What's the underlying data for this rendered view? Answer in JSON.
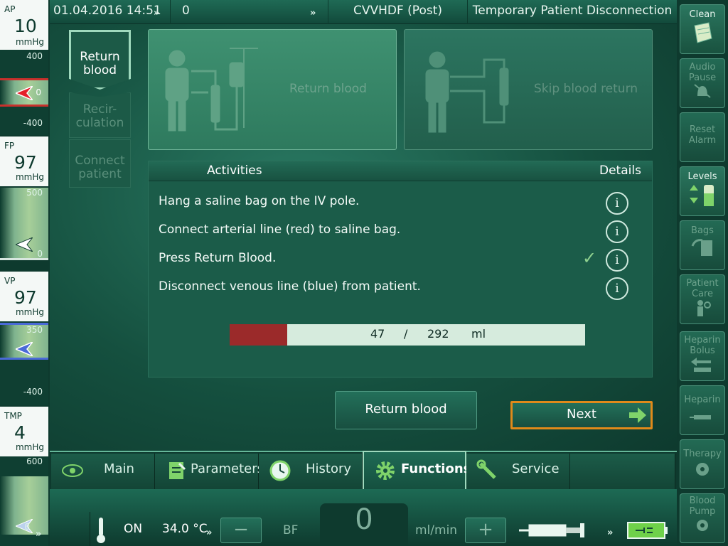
{
  "topbar": {
    "datetime": "01.04.2016 14:51",
    "counter": "0",
    "mode": "CVVHDF (Post)",
    "screen_title": "Temporary Patient Disconnection",
    "more_glyph": "»"
  },
  "pressures": {
    "ap": {
      "name": "AP",
      "value": "10",
      "unit": "mmHg",
      "upper": "400",
      "current": "0",
      "lower": "-400",
      "color": "#e5202a"
    },
    "fp": {
      "name": "FP",
      "value": "97",
      "unit": "mmHg",
      "upper": "500",
      "lower": "0",
      "color": "#ffffff"
    },
    "vp": {
      "name": "VP",
      "value": "97",
      "unit": "mmHg",
      "upper": "350",
      "lower": "-400",
      "color": "#4a6ad8"
    },
    "tmp": {
      "name": "TMP",
      "value": "4",
      "unit": "mmHg",
      "upper": "600",
      "lower": "0",
      "color": "#bcd2ee"
    }
  },
  "steps": [
    {
      "label_line1": "Return",
      "label_line2": "blood",
      "active": true
    },
    {
      "label_line1": "Recir-",
      "label_line2": "culation",
      "active": false
    },
    {
      "label_line1": "Connect",
      "label_line2": "patient",
      "active": false
    }
  ],
  "cards": {
    "return_blood": "Return blood",
    "skip_return": "Skip blood return"
  },
  "activities": {
    "header_activities": "Activities",
    "header_details": "Details",
    "items": [
      {
        "text": "Hang a saline bag on the IV pole.",
        "done": false
      },
      {
        "text": "Connect arterial line (red) to saline bag.",
        "done": false
      },
      {
        "text": "Press Return Blood.",
        "done": true
      },
      {
        "text": "Disconnect venous line (blue) from patient.",
        "done": false
      }
    ],
    "info_glyph": "i",
    "check_glyph": "✓",
    "progress": {
      "current": "47",
      "separator": "/",
      "total": "292",
      "unit": "ml",
      "fraction": 0.161
    }
  },
  "buttons": {
    "return_blood": "Return blood",
    "next": "Next"
  },
  "tabs": [
    {
      "label": "Main",
      "icon": "eye-icon"
    },
    {
      "label": "Parameters",
      "icon": "notepad-icon"
    },
    {
      "label": "History",
      "icon": "clock-icon"
    },
    {
      "label": "Functions",
      "icon": "gear-icon",
      "active": true
    },
    {
      "label": "Service",
      "icon": "wrench-icon"
    }
  ],
  "bottom": {
    "heater_state": "ON",
    "temperature": "34.0 °C",
    "minus": "−",
    "bf_label": "BF",
    "bf_value": "0",
    "bf_unit": "ml/min",
    "plus": "+"
  },
  "right_buttons": [
    {
      "line1": "Clean",
      "line2": "",
      "enabled": true
    },
    {
      "line1": "Audio",
      "line2": "Pause",
      "enabled": false
    },
    {
      "line1": "Reset",
      "line2": "Alarm",
      "enabled": false
    },
    {
      "line1": "Levels",
      "line2": "",
      "enabled": true
    },
    {
      "line1": "Bags",
      "line2": "",
      "enabled": false
    },
    {
      "line1": "Patient",
      "line2": "Care",
      "enabled": false
    },
    {
      "line1": "Heparin",
      "line2": "Bolus",
      "enabled": false
    },
    {
      "line1": "Heparin",
      "line2": "",
      "enabled": false
    },
    {
      "line1": "Therapy",
      "line2": "",
      "enabled": false
    },
    {
      "line1": "Blood",
      "line2": "Pump",
      "enabled": false
    }
  ],
  "colors": {
    "accent_next_border": "#e08a1a",
    "progress_fill": "#9b2a2a",
    "progress_track": "#d6ebdd",
    "check": "#8fd18f"
  }
}
